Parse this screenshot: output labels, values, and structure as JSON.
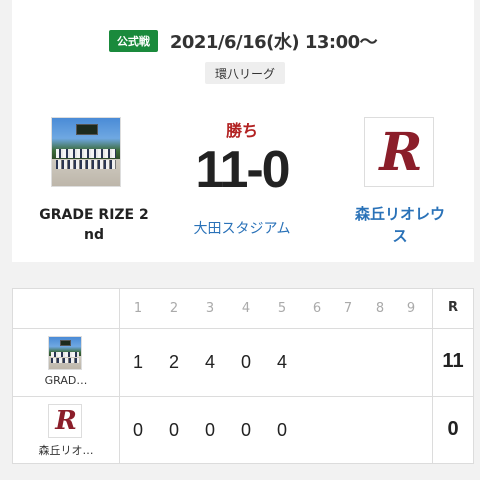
{
  "match": {
    "badge": "公式戦",
    "datetime": "2021/6/16(水) 13:00〜",
    "league": "環八リーグ",
    "result": "勝ち",
    "score": "11-0",
    "venue": "大田スタジアム"
  },
  "teams": {
    "home": {
      "name": "GRADE RIZE 2nd",
      "name_line1": "GRADE RIZE 2",
      "name_line2": "nd",
      "short": "GRAD…",
      "image": "team-photo"
    },
    "away": {
      "name": "森丘リオレウス",
      "name_line1": "森丘リオレウ",
      "name_line2": "ス",
      "short": "森丘リオ…",
      "logo_text": "R"
    }
  },
  "scoreboard": {
    "innings": [
      "1",
      "2",
      "3",
      "4",
      "5",
      "6",
      "7",
      "8",
      "9"
    ],
    "total_label": "R",
    "rows": [
      {
        "team": "GRAD…",
        "runs": [
          "1",
          "2",
          "4",
          "0",
          "4",
          "",
          "",
          "",
          ""
        ],
        "total": "11"
      },
      {
        "team": "森丘リオ…",
        "runs": [
          "0",
          "0",
          "0",
          "0",
          "0",
          "",
          "",
          "",
          ""
        ],
        "total": "0"
      }
    ]
  },
  "colors": {
    "badge_green": "#1a8a3c",
    "win_red": "#b22222",
    "link_blue": "#2a72b8",
    "logo_maroon": "#8b1e2a"
  }
}
